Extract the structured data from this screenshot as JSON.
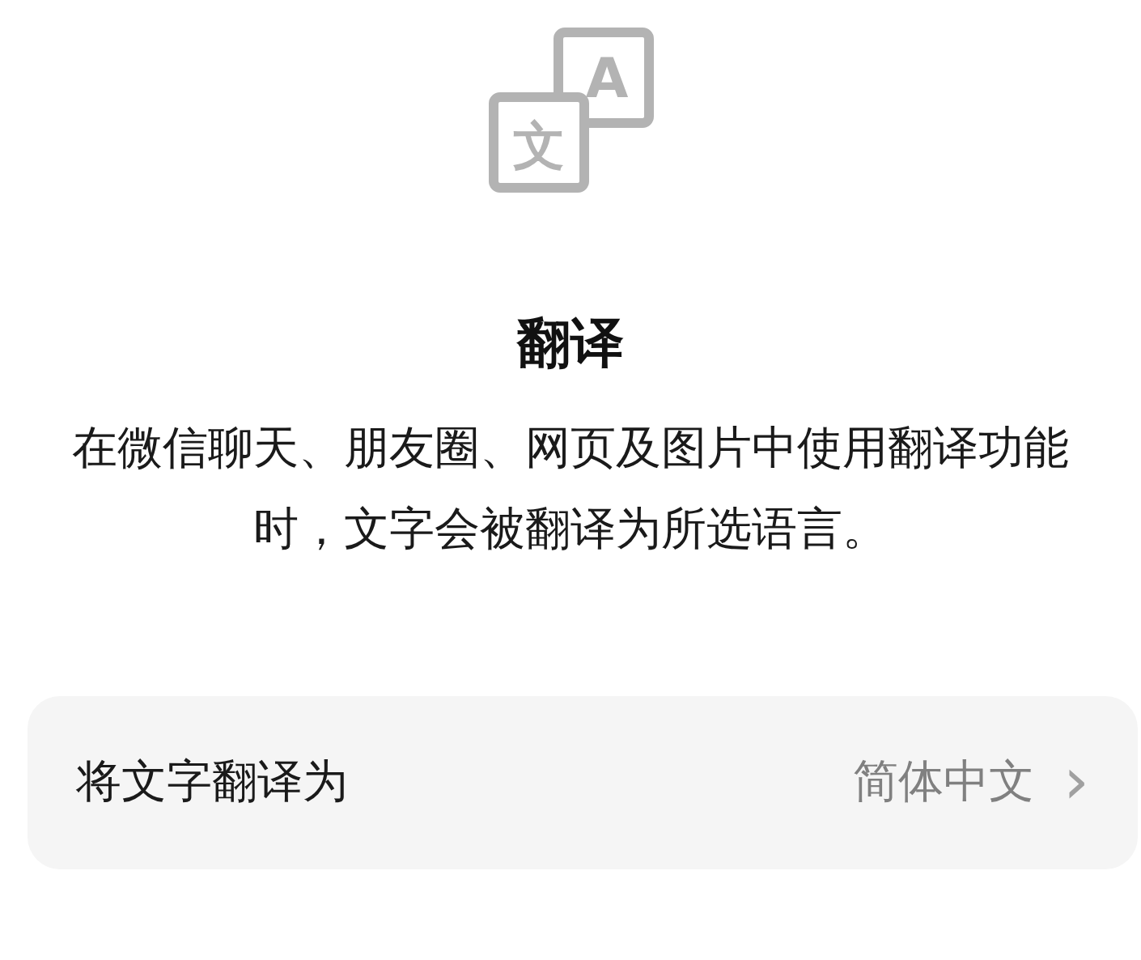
{
  "icon": {
    "back_glyph": "A",
    "front_glyph": "文"
  },
  "title": "翻译",
  "description": "在微信聊天、朋友圈、网页及图片中使用翻译功能时，文字会被翻译为所选语言。",
  "setting": {
    "label": "将文字翻译为",
    "value": "简体中文",
    "chevron": "›"
  }
}
